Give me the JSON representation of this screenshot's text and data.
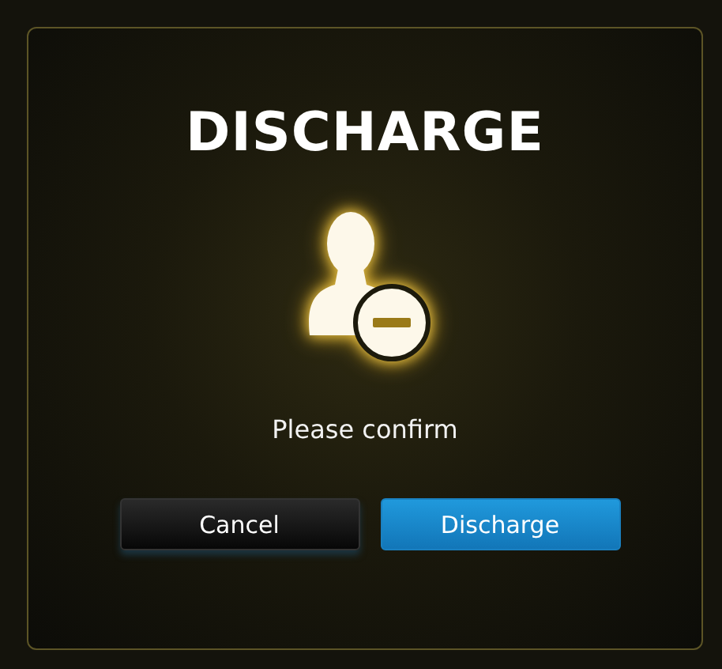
{
  "dialog": {
    "title": "DISCHARGE",
    "message": "Please confirm",
    "buttons": [
      {
        "label": "Cancel",
        "kind": "secondary"
      },
      {
        "label": "Discharge",
        "kind": "primary"
      }
    ]
  }
}
